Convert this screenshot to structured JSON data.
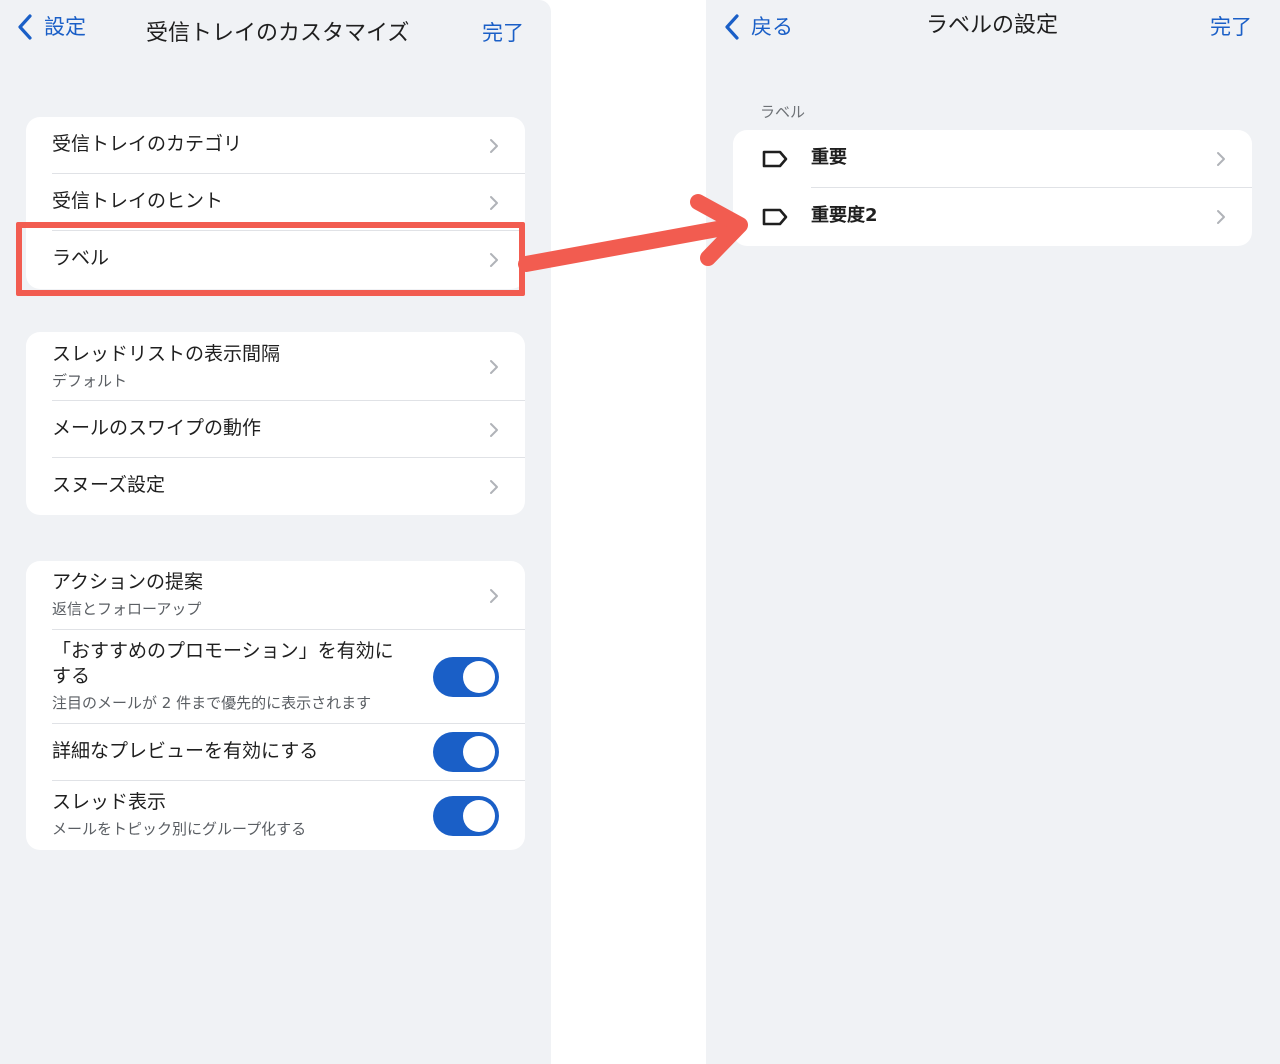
{
  "left": {
    "nav": {
      "back_label": "設定",
      "title": "受信トレイのカスタマイズ",
      "done_label": "完了"
    },
    "group1": [
      {
        "label": "受信トレイのカテゴリ"
      },
      {
        "label": "受信トレイのヒント"
      },
      {
        "label": "ラベル",
        "highlighted": true
      }
    ],
    "group2": [
      {
        "label": "スレッドリストの表示間隔",
        "sub": "デフォルト"
      },
      {
        "label": "メールのスワイプの動作"
      },
      {
        "label": "スヌーズ設定"
      }
    ],
    "group3": [
      {
        "label": "アクションの提案",
        "sub": "返信とフォローアップ"
      },
      {
        "label_line1": "「おすすめのプロモーション」を有効に",
        "label_line2": "する",
        "sub": "注目のメールが 2 件まで優先的に表示されます",
        "toggle": "on"
      },
      {
        "label": "詳細なプレビューを有効にする",
        "toggle": "on"
      },
      {
        "label": "スレッド表示",
        "sub": "メールをトピック別にグループ化する",
        "toggle": "on"
      }
    ]
  },
  "right": {
    "nav": {
      "back_label": "戻る",
      "title": "ラベルの設定",
      "done_label": "完了"
    },
    "section_header": "ラベル",
    "labels": [
      {
        "name": "重要",
        "icon": "label-tag-icon"
      },
      {
        "name": "重要度2",
        "icon": "label-tag-icon"
      }
    ]
  },
  "colors": {
    "accent": "#1a5fc7",
    "background": "#f0f2f5",
    "card": "#ffffff",
    "highlight": "#f25c50"
  }
}
